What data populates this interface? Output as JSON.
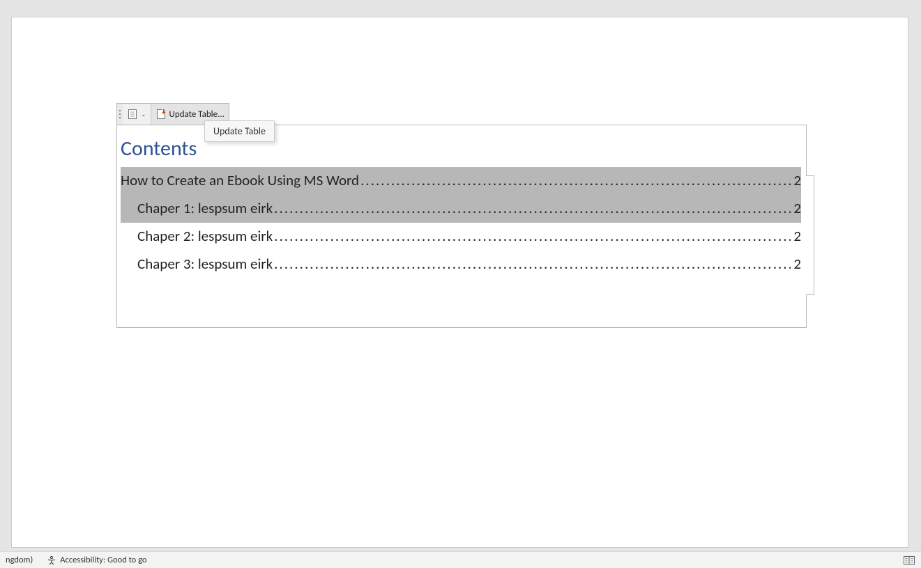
{
  "toolbar": {
    "update_table_button": "Update Table..."
  },
  "tooltip": {
    "update_table": "Update Table"
  },
  "toc": {
    "heading": "Contents",
    "entries": [
      {
        "level": 1,
        "title": "How to Create an Ebook Using MS Word",
        "page": "2",
        "selected": true
      },
      {
        "level": 2,
        "title": "Chaper 1: lespsum eirk",
        "page": "2",
        "selected": true
      },
      {
        "level": 2,
        "title": "Chaper 2: lespsum eirk",
        "page": "2",
        "selected": false
      },
      {
        "level": 2,
        "title": "Chaper 3: lespsum eirk",
        "page": "2",
        "selected": false
      }
    ]
  },
  "statusbar": {
    "language_fragment": "ngdom)",
    "accessibility": "Accessibility: Good to go"
  },
  "dots": "...................................................................................................................................................................................................................................."
}
